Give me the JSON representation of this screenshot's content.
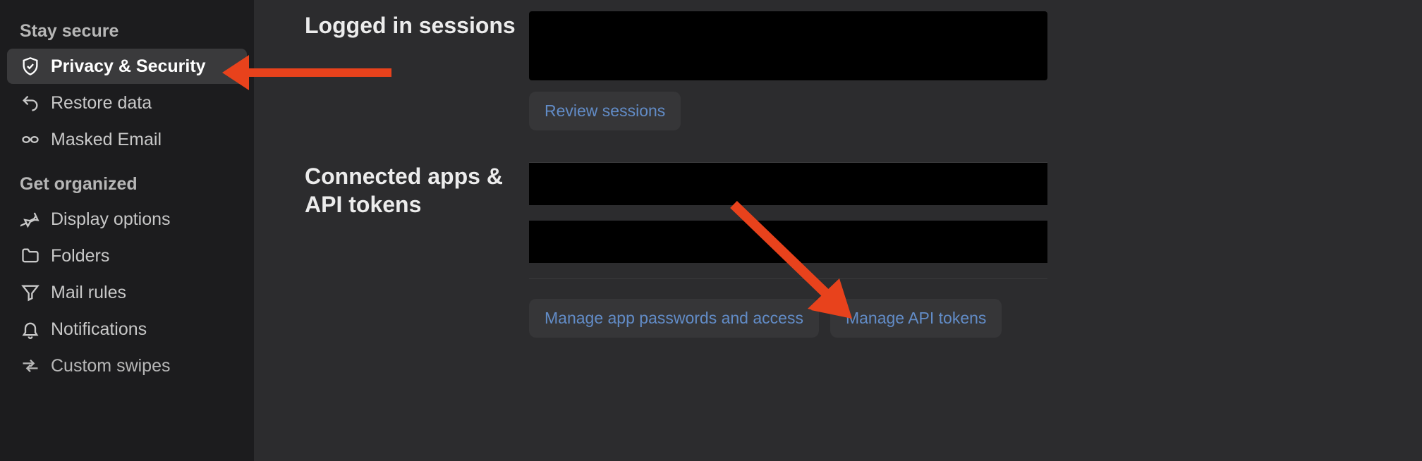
{
  "sidebar": {
    "sections": [
      {
        "header": "Stay secure",
        "items": [
          {
            "label": "Privacy & Security",
            "icon": "shield-check",
            "active": true
          },
          {
            "label": "Restore data",
            "icon": "undo",
            "active": false
          },
          {
            "label": "Masked Email",
            "icon": "mask",
            "active": false
          }
        ]
      },
      {
        "header": "Get organized",
        "items": [
          {
            "label": "Display options",
            "icon": "thumbtack",
            "active": false
          },
          {
            "label": "Folders",
            "icon": "folder",
            "active": false
          },
          {
            "label": "Mail rules",
            "icon": "funnel",
            "active": false
          },
          {
            "label": "Notifications",
            "icon": "bell",
            "active": false
          },
          {
            "label": "Custom swipes",
            "icon": "swipe",
            "active": false
          }
        ]
      }
    ]
  },
  "sections": {
    "sessions": {
      "title": "Logged in sessions",
      "review_button": "Review sessions"
    },
    "connected": {
      "title": "Connected apps & API tokens",
      "manage_passwords_button": "Manage app passwords and access",
      "manage_tokens_button": "Manage API tokens"
    }
  },
  "annotations": {
    "arrow_color": "#e8421c"
  }
}
